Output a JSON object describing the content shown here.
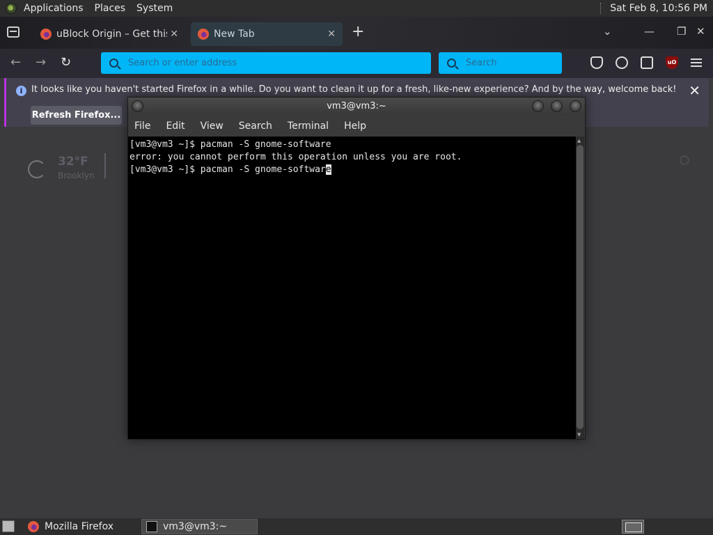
{
  "top_panel": {
    "menus": [
      "Applications",
      "Places",
      "System"
    ],
    "clock": "Sat Feb  8, 10:56 PM"
  },
  "firefox": {
    "tabs": [
      {
        "title": "uBlock Origin – Get this Exte",
        "active": false
      },
      {
        "title": "New Tab",
        "active": true
      }
    ],
    "url_placeholder": "Search or enter address",
    "search_placeholder": "Search",
    "notification": {
      "message": "It looks like you haven't started Firefox in a while. Do you want to clean it up for a fresh, like-new experience? And by the way, welcome back!",
      "button": "Refresh Firefox..."
    },
    "weather": {
      "temperature": "32°F",
      "city": "Brooklyn"
    },
    "ublock_badge": "uO"
  },
  "terminal": {
    "title": "vm3@vm3:~",
    "menu": [
      "File",
      "Edit",
      "View",
      "Search",
      "Terminal",
      "Help"
    ],
    "lines": [
      "[vm3@vm3 ~]$ pacman -S gnome-software",
      "error: you cannot perform this operation unless you are root.",
      "[vm3@vm3 ~]$ pacman -S gnome-softwar"
    ],
    "cursor_char": "e"
  },
  "taskbar": {
    "tasks": [
      {
        "label": "Mozilla Firefox",
        "active": false
      },
      {
        "label": "vm3@vm3:~",
        "active": true
      }
    ]
  },
  "colors": {
    "accent_blue": "#00b6f7",
    "notification_accent": "#b833e1"
  }
}
